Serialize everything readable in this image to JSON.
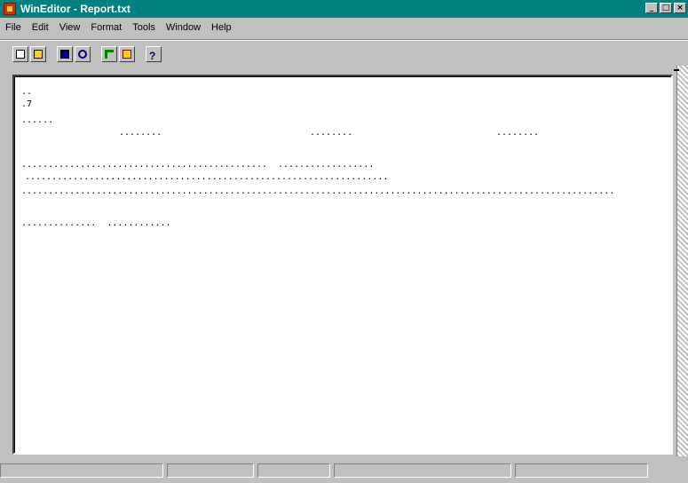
{
  "window": {
    "title": "WinEditor - Report.txt"
  },
  "menu": {
    "items": [
      "File",
      "Edit",
      "View",
      "Format",
      "Tools",
      "Window",
      "Help"
    ]
  },
  "toolbar": {
    "icons": [
      "new-file-icon",
      "open-folder-icon",
      "save-icon",
      "find-icon",
      "undo-icon",
      "redo-icon",
      "help-icon"
    ]
  },
  "document": {
    "line1": "..",
    "line2": ".7",
    "line3": "......",
    "col1": "........",
    "col2": "........",
    "col3": "........",
    "line4": "..............................................  ..................",
    "line5": "....................................................................",
    "separator": "...............................................................................................................",
    "line6": "..............  ............"
  },
  "status": {
    "cells": [
      "",
      "",
      "",
      "",
      ""
    ]
  }
}
